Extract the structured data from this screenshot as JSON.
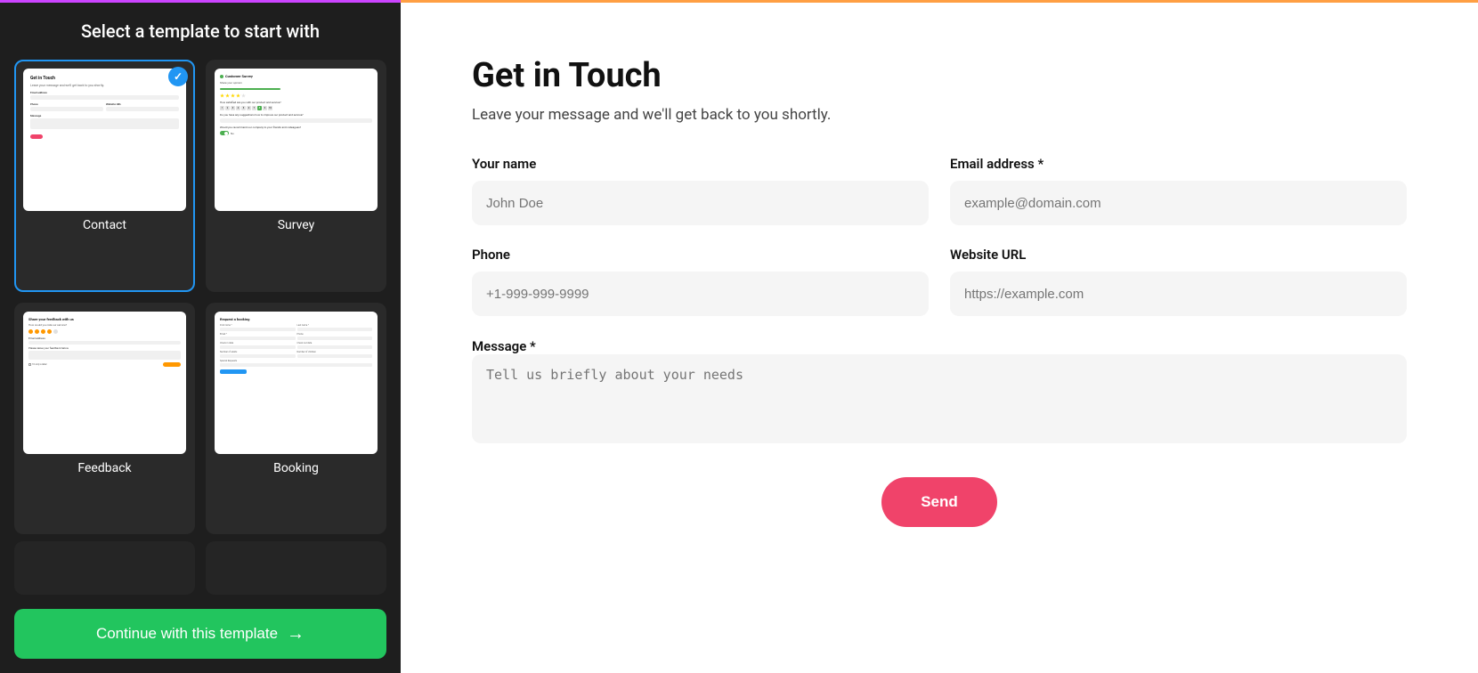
{
  "leftPanel": {
    "title": "Select a template to start with",
    "templates": [
      {
        "id": "contact",
        "name": "Contact",
        "selected": true
      },
      {
        "id": "survey",
        "name": "Survey",
        "selected": false
      },
      {
        "id": "feedback",
        "name": "Feedback",
        "selected": false
      },
      {
        "id": "booking",
        "name": "Booking",
        "selected": false
      }
    ],
    "continueButton": "Continue with this template"
  },
  "rightPanel": {
    "title": "Get in Touch",
    "subtitle": "Leave your message and we'll get back to you shortly.",
    "fields": {
      "yourName": {
        "label": "Your name",
        "placeholder": "John Doe"
      },
      "emailAddress": {
        "label": "Email address *",
        "placeholder": "example@domain.com"
      },
      "phone": {
        "label": "Phone",
        "placeholder": "+1-999-999-9999"
      },
      "websiteUrl": {
        "label": "Website URL",
        "placeholder": "https://example.com"
      },
      "message": {
        "label": "Message *",
        "placeholder": "Tell us briefly about your needs"
      }
    },
    "sendButton": "Send"
  }
}
